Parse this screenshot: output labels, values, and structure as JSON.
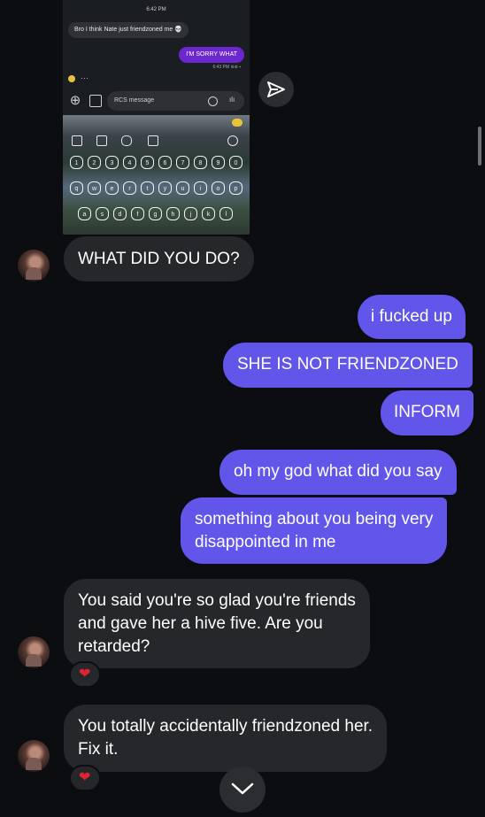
{
  "screenshot": {
    "time": "6:42 PM",
    "incoming": "Bro I think Nate just friendzoned me 💀",
    "outgoing": "I'M SORRY WHAT",
    "outgoing_meta": "6:43 PM",
    "typing_dots": "···",
    "input_placeholder": "RCS message",
    "keyboard_numbers": [
      "1",
      "2",
      "3",
      "4",
      "5",
      "6",
      "7",
      "8",
      "9",
      "0"
    ],
    "keyboard_row2": [
      "q",
      "w",
      "e",
      "r",
      "t",
      "y",
      "u",
      "i",
      "o",
      "p"
    ],
    "keyboard_row3": [
      "a",
      "s",
      "d",
      "f",
      "g",
      "h",
      "j",
      "k",
      "l"
    ]
  },
  "messages": {
    "m1": "WHAT DID YOU DO?",
    "m2": "i fucked up",
    "m3": "SHE IS NOT FRIENDZONED",
    "m4": "INFORM",
    "m5": "oh my god what did you say",
    "m6_l1": "something about you being very",
    "m6_l2": "disappointed in me",
    "m7_l1": "You said you're so glad you're friends",
    "m7_l2": "and gave her a hive five. Are you",
    "m7_l3": "retarded?",
    "m8_l1": "You totally accidentally friendzoned her.",
    "m8_l2": "Fix it."
  },
  "reactions": {
    "r1": "❤",
    "r2": "❤"
  },
  "colors": {
    "background": "#0c0d10",
    "incoming_bubble": "#26272b",
    "outgoing_bubble": "#6155ea",
    "heart": "#e0242f"
  },
  "icons": {
    "send": "paper-plane-icon",
    "scroll_down": "chevron-down-icon"
  }
}
